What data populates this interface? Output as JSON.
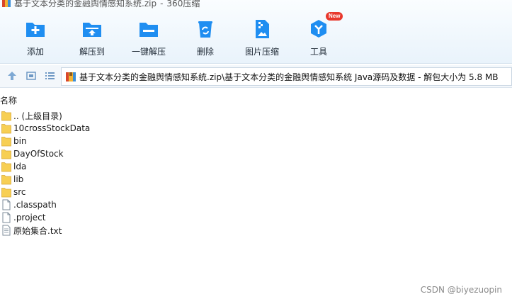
{
  "window": {
    "archive_name": "基于文本分类的金融舆情感知系统.zip",
    "separator": "-",
    "app_name": "360压缩"
  },
  "toolbar": {
    "add": "添加",
    "extract_to": "解压到",
    "one_click_extract": "一键解压",
    "delete": "删除",
    "image_compress": "图片压缩",
    "tools": "工具",
    "new_badge": "New"
  },
  "address": {
    "path": "基于文本分类的金融舆情感知系统.zip\\基于文本分类的金融舆情感知系统 Java源码及数据 - 解包大小为 5.8 MB"
  },
  "list": {
    "column_name": "名称",
    "items": [
      {
        "name": ".. (上级目录)",
        "type": "folder"
      },
      {
        "name": "10crossStockData",
        "type": "folder"
      },
      {
        "name": "bin",
        "type": "folder"
      },
      {
        "name": "DayOfStock",
        "type": "folder"
      },
      {
        "name": "lda",
        "type": "folder"
      },
      {
        "name": "lib",
        "type": "folder"
      },
      {
        "name": "src",
        "type": "folder"
      },
      {
        "name": ".classpath",
        "type": "file"
      },
      {
        "name": ".project",
        "type": "file"
      },
      {
        "name": "原始集合.txt",
        "type": "text"
      }
    ]
  },
  "watermark": "CSDN @biyezuopin",
  "colors": {
    "icon_blue": "#1f8ef1",
    "folder_yellow": "#f7cf54",
    "badge_red": "#e8372c"
  }
}
